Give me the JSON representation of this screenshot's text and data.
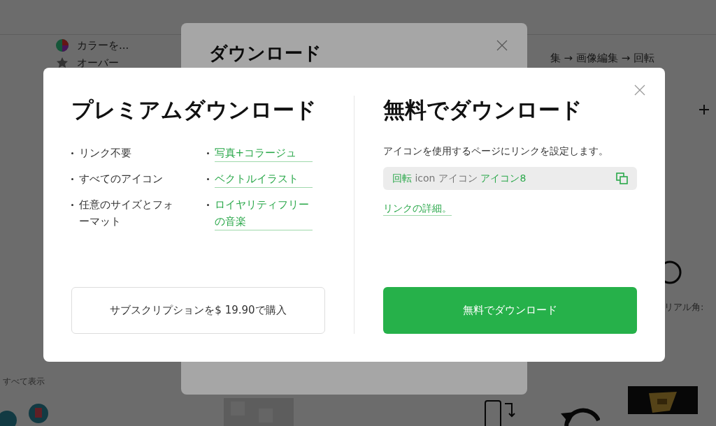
{
  "page": {
    "sidebar_items": [
      {
        "label": "カラーを..."
      },
      {
        "label": "オーバー"
      }
    ],
    "show_all": "すべて表示",
    "breadcrumb": "集 → 画像編集 → 回転",
    "side_label": "リアル角:"
  },
  "back_dialog": {
    "title": "ダウンロード"
  },
  "dialog": {
    "premium": {
      "title": "プレミアムダウンロード",
      "features": [
        {
          "label": "リンク不要",
          "kind": "text"
        },
        {
          "label": "写真+コラージュ",
          "kind": "link"
        },
        {
          "label": "すべてのアイコン",
          "kind": "text"
        },
        {
          "label": "ベクトルイラスト",
          "kind": "link"
        },
        {
          "label": "任意のサイズとフォーマット",
          "kind": "text"
        },
        {
          "label": "ロイヤリティフリーの音楽",
          "kind": "link"
        }
      ],
      "button": "サブスクリプションを$ 19.90で購入"
    },
    "free": {
      "title": "無料でダウンロード",
      "description": "アイコンを使用するページにリンクを設定します。",
      "attribution": [
        {
          "text": "回転",
          "kind": "link"
        },
        {
          "text": " icon アイコン ",
          "kind": "text"
        },
        {
          "text": "アイコン8",
          "kind": "link"
        }
      ],
      "details_link": "リンクの詳細。",
      "button": "無料でダウンロード"
    }
  }
}
